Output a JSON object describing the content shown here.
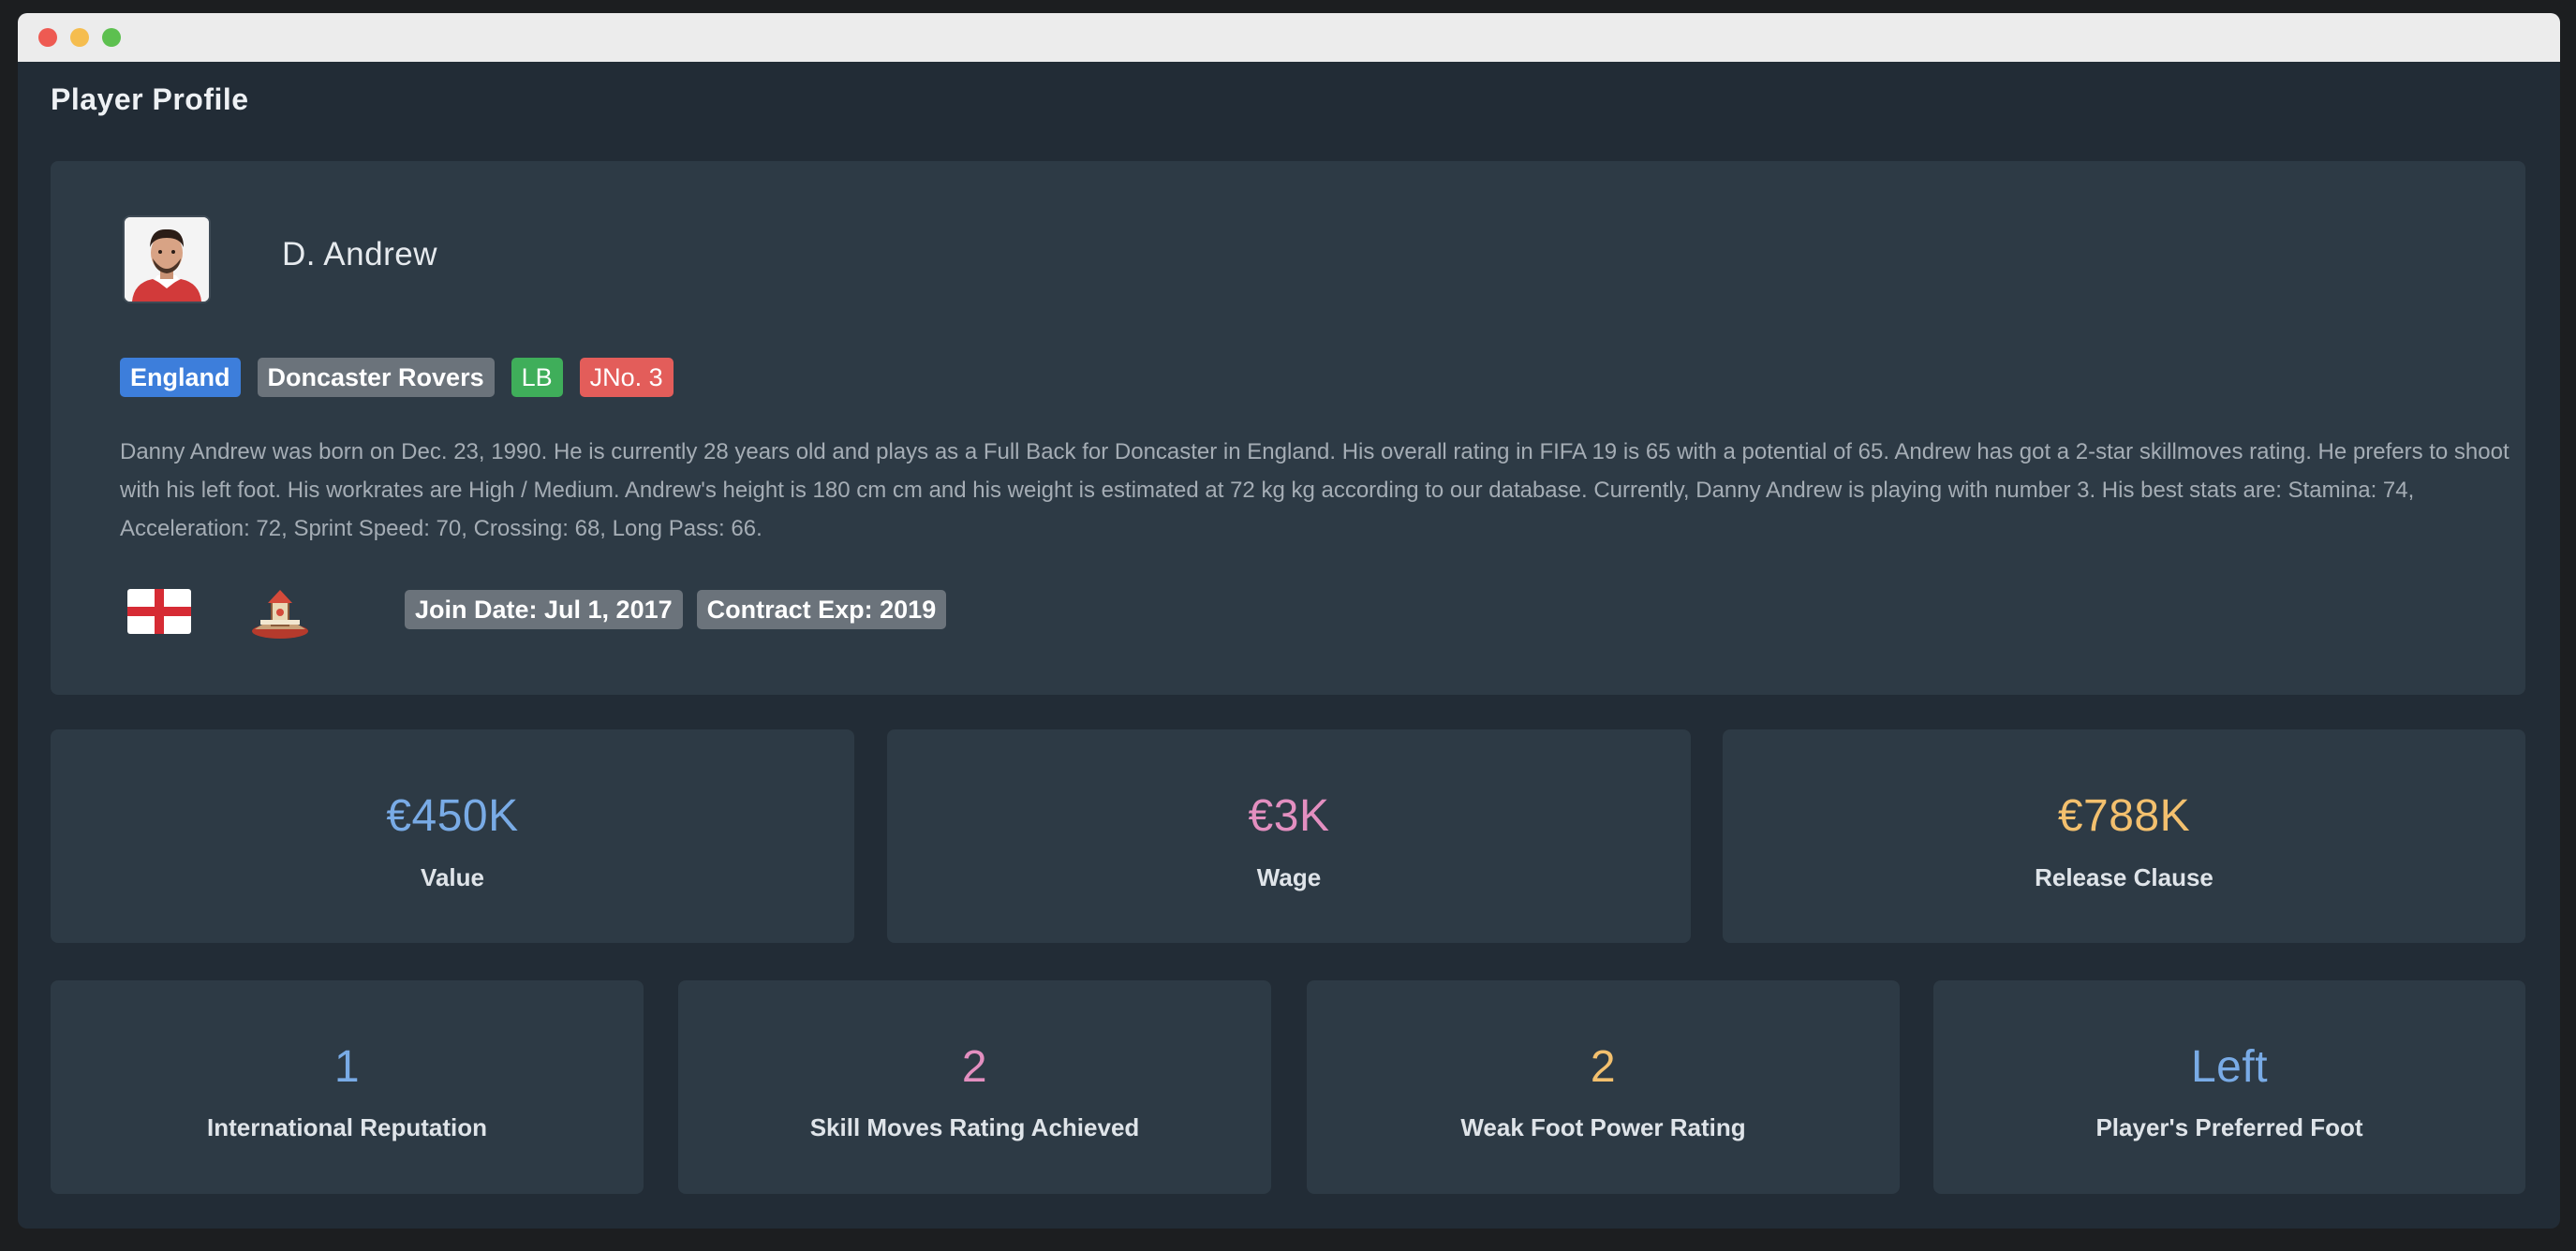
{
  "window": {
    "title": "Player Profile"
  },
  "player": {
    "name": "D. Andrew",
    "badges": {
      "nation": "England",
      "club": "Doncaster Rovers",
      "position": "LB",
      "jersey": "JNo. 3"
    },
    "description": "Danny Andrew was born on Dec. 23, 1990. He is currently 28 years old and plays as a Full Back for Doncaster in England. His overall rating in FIFA 19 is 65 with a potential of 65. Andrew has got a 2-star skillmoves rating. He prefers to shoot with his left foot. His workrates are High / Medium. Andrew's height is 180 cm cm and his weight is estimated at 72 kg kg according to our database. Currently, Danny Andrew is playing with number 3. His best stats are: Stamina: 74, Acceleration: 72, Sprint Speed: 70, Crossing: 68, Long Pass: 66.",
    "join_date": "Join Date: Jul 1, 2017",
    "contract_exp": "Contract Exp: 2019",
    "icons": {
      "avatar": "player-photo",
      "flag": "england-flag-icon",
      "crest": "club-crest-icon"
    }
  },
  "stats_row1": [
    {
      "value": "€450K",
      "label": "Value",
      "color": "#79abe6"
    },
    {
      "value": "€3K",
      "label": "Wage",
      "color": "#e38fc0"
    },
    {
      "value": "€788K",
      "label": "Release Clause",
      "color": "#f3c06e"
    }
  ],
  "stats_row2": [
    {
      "value": "1",
      "label": "International Reputation",
      "color": "#79abe6"
    },
    {
      "value": "2",
      "label": "Skill Moves Rating Achieved",
      "color": "#e38fc0"
    },
    {
      "value": "2",
      "label": "Weak Foot Power Rating",
      "color": "#f3c06e"
    },
    {
      "value": "Left",
      "label": "Player's Preferred Foot",
      "color": "#79abe6"
    }
  ],
  "colors": {
    "background": "#222c36",
    "card": "#2d3a45",
    "badge_blue": "#3d7edb",
    "badge_gray": "#6b737b",
    "badge_green": "#3fae5a",
    "badge_red": "#e35d5a"
  }
}
